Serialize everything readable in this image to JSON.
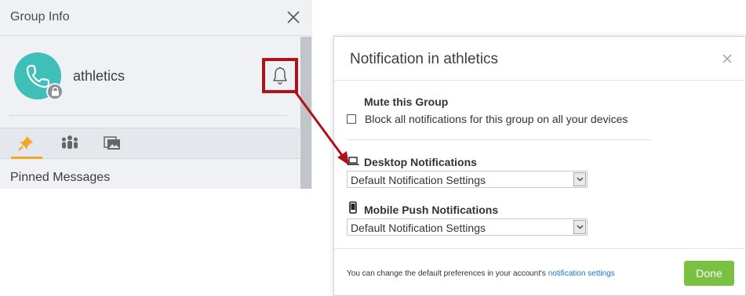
{
  "group_info": {
    "title": "Group Info",
    "group_name": "athletics",
    "pinned_heading": "Pinned Messages",
    "tabs": [
      {
        "name": "pinned",
        "icon": "pin-icon"
      },
      {
        "name": "members",
        "icon": "people-icon"
      },
      {
        "name": "media",
        "icon": "gallery-icon"
      }
    ]
  },
  "modal": {
    "title": "Notification in athletics",
    "mute_title": "Mute this Group",
    "mute_label": "Block all notifications for this group on all your devices",
    "mute_checked": false,
    "desktop_title": "Desktop Notifications",
    "desktop_value": "Default Notification Settings",
    "mobile_title": "Mobile Push Notifications",
    "mobile_value": "Default Notification Settings",
    "footer_text": "You can change the default preferences in your account's",
    "footer_link": "notification settings",
    "done_label": "Done"
  },
  "colors": {
    "avatar": "#3ebfb8",
    "highlight_box": "#b0121b",
    "tab_underline": "#f5a623",
    "done_button": "#7ac142",
    "link": "#1a73c9"
  }
}
